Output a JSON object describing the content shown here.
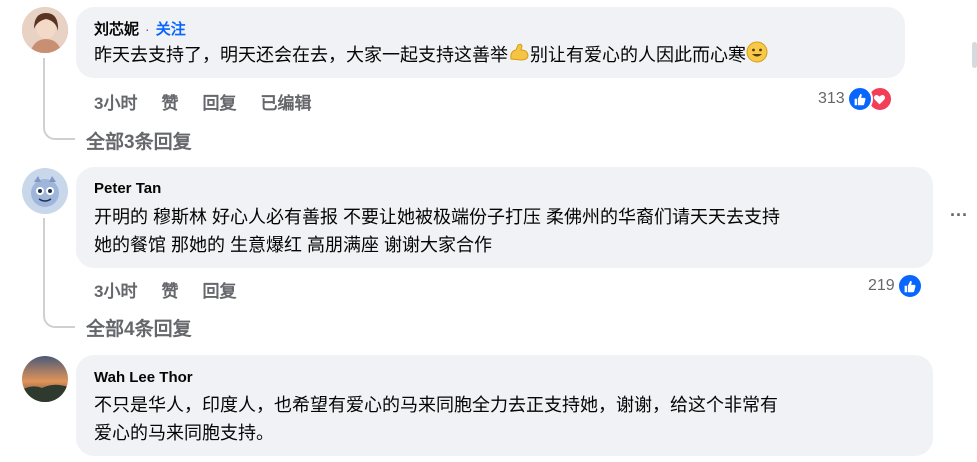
{
  "comments": [
    {
      "author": "刘芯妮",
      "follow_label": "关注",
      "text_before_emoji": "昨天去支持了，明天还会在去，大家一起支持这善举",
      "text_middle": "别让有爱心的人因此而心寒",
      "emojis": [
        "flexed-biceps-icon",
        "smiling-face-icon"
      ],
      "time": "3小时",
      "like_label": "赞",
      "reply_label": "回复",
      "edited_label": "已编辑",
      "reaction_count": "313",
      "reactions": [
        "like-icon",
        "love-icon"
      ],
      "replies_label": "全部3条回复"
    },
    {
      "author": "Peter Tan",
      "text_line1": "开明的 穆斯林 好心人必有善报 不要让她被极端份子打压 柔佛州的华裔们请天天去支持",
      "text_line2": "她的餐馆 那她的 生意爆红 高朋满座 谢谢大家合作",
      "time": "3小时",
      "like_label": "赞",
      "reply_label": "回复",
      "reaction_count": "219",
      "reactions": [
        "like-icon"
      ],
      "more_label": "···",
      "replies_label": "全部4条回复"
    },
    {
      "author": "Wah Lee Thor",
      "text_line1": "不只是华人，印度人，也希望有爱心的马来同胞全力去正支持她，谢谢，给这个非常有",
      "text_line2": "爱心的马来同胞支持。"
    }
  ],
  "colors": {
    "accent": "#0866ff",
    "love": "#f33e58",
    "bubble": "#f0f2f5",
    "muted": "#65676b"
  }
}
